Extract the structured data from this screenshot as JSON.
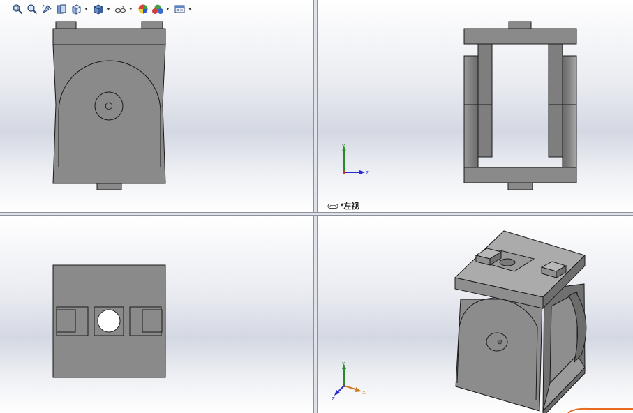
{
  "toolbar": {
    "buttons": [
      {
        "icon": "zoom-to-fit-icon",
        "dropdown": false
      },
      {
        "icon": "zoom-to-area-icon",
        "dropdown": false
      },
      {
        "icon": "previous-view-icon",
        "dropdown": false
      },
      {
        "icon": "section-view-icon",
        "dropdown": false
      },
      {
        "icon": "view-orientation-icon",
        "dropdown": true
      },
      {
        "icon": "display-style-icon",
        "dropdown": true
      },
      {
        "icon": "hide-show-items-icon",
        "dropdown": true
      },
      {
        "icon": "edit-appearance-icon",
        "dropdown": false
      },
      {
        "icon": "apply-scene-icon",
        "dropdown": true
      },
      {
        "icon": "view-settings-icon",
        "dropdown": true
      }
    ]
  },
  "viewports": {
    "left_view": {
      "label": "*左视"
    }
  },
  "triad": {
    "left": {
      "y": "Y",
      "z": "Z"
    },
    "iso": {
      "y": "Y",
      "z": "Z",
      "x": "X"
    }
  },
  "colors": {
    "part_face": "#8a8a8a",
    "part_face_dark": "#707070",
    "part_face_light": "#a8a8a8",
    "edge": "#1a1a1a",
    "axis_x": "#d03030",
    "axis_y": "#2a8a2a",
    "axis_z": "#2a2ad0"
  }
}
